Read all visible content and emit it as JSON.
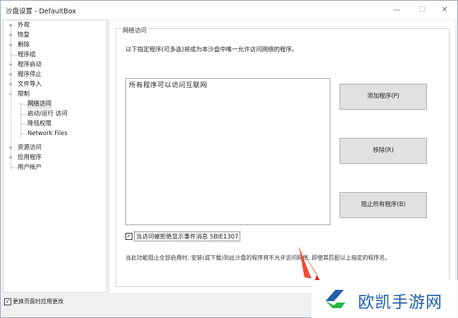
{
  "window": {
    "title": "沙盘设置 - DefaultBox",
    "minimize_glyph": "—",
    "maximize_glyph": "☐",
    "close_glyph": "✕"
  },
  "sidebar": {
    "items": [
      {
        "label": "外观",
        "expander": "+",
        "level": 0
      },
      {
        "label": "恢复",
        "expander": "+",
        "level": 0
      },
      {
        "label": "删除",
        "expander": "+",
        "level": 0
      },
      {
        "label": "程序组",
        "expander": "",
        "level": 0
      },
      {
        "label": "程序启动",
        "expander": "+",
        "level": 0
      },
      {
        "label": "程序停止",
        "expander": "+",
        "level": 0
      },
      {
        "label": "文件导入",
        "expander": "+",
        "level": 0
      },
      {
        "label": "限制",
        "expander": "−",
        "level": 0
      },
      {
        "label": "网络访问",
        "expander": "",
        "level": 1,
        "selected": true
      },
      {
        "label": "启动/运行 访问",
        "expander": "",
        "level": 1
      },
      {
        "label": "降低权限",
        "expander": "",
        "level": 1
      },
      {
        "label": "Network Files",
        "expander": "",
        "level": 1
      },
      {
        "label": "资源访问",
        "expander": "+",
        "level": 0
      },
      {
        "label": "应用程序",
        "expander": "+",
        "level": 0
      },
      {
        "label": "用户帐户",
        "expander": "",
        "level": 0
      }
    ]
  },
  "main": {
    "group_title": "网络访问",
    "description": "以下指定程序(可多选)将成为本沙盘中唯一允许访问网络的程序。",
    "program_list": [
      "所有程序可以访问互联网"
    ],
    "buttons": {
      "add": "添加程序(P)",
      "remove": "移除(R)",
      "block_all": "阻止所有程序(B)"
    },
    "checkbox": {
      "label": "当访问被拒绝显示事件消息 SBIE1307",
      "checked": true,
      "glyph": "✓"
    },
    "note": "当此功能阻止全部启用时, 安装(或下载)到此沙盘的程序将不允许访问网络, 即使其匹配以上指定的程序名。"
  },
  "footer": {
    "apply_on_page_change": {
      "label": "更换页面时应用更改",
      "checked": true,
      "glyph": "✓"
    }
  },
  "watermark": {
    "text": "欧凯手游网",
    "color": "#1f5fa8"
  }
}
